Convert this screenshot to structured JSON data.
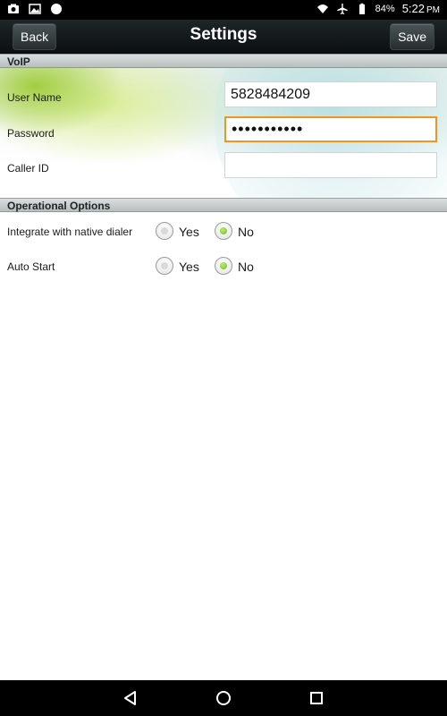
{
  "status_bar": {
    "battery": "84%",
    "time": "5:22",
    "ampm": "PM",
    "icons": [
      "camera-icon",
      "image-icon",
      "circle-icon",
      "wifi-icon",
      "airplane-icon",
      "battery-icon"
    ]
  },
  "title_bar": {
    "title": "Settings",
    "back_label": "Back",
    "save_label": "Save"
  },
  "voip": {
    "header": "VoIP",
    "user_name_label": "User Name",
    "user_name_value": "5828484209",
    "password_label": "Password",
    "password_value": "•••••••••••",
    "caller_id_label": "Caller ID",
    "caller_id_value": ""
  },
  "options": {
    "header": "Operational Options",
    "items": [
      {
        "label": "Integrate with native dialer",
        "yes": "Yes",
        "no": "No",
        "selected": "No"
      },
      {
        "label": "Auto Start",
        "yes": "Yes",
        "no": "No",
        "selected": "No"
      }
    ]
  },
  "nav_bar": {
    "icons": [
      "back-triangle-icon",
      "home-circle-icon",
      "recents-square-icon"
    ]
  },
  "colors": {
    "focus": "#f0961e",
    "radio_selected": "#6fbf20"
  }
}
